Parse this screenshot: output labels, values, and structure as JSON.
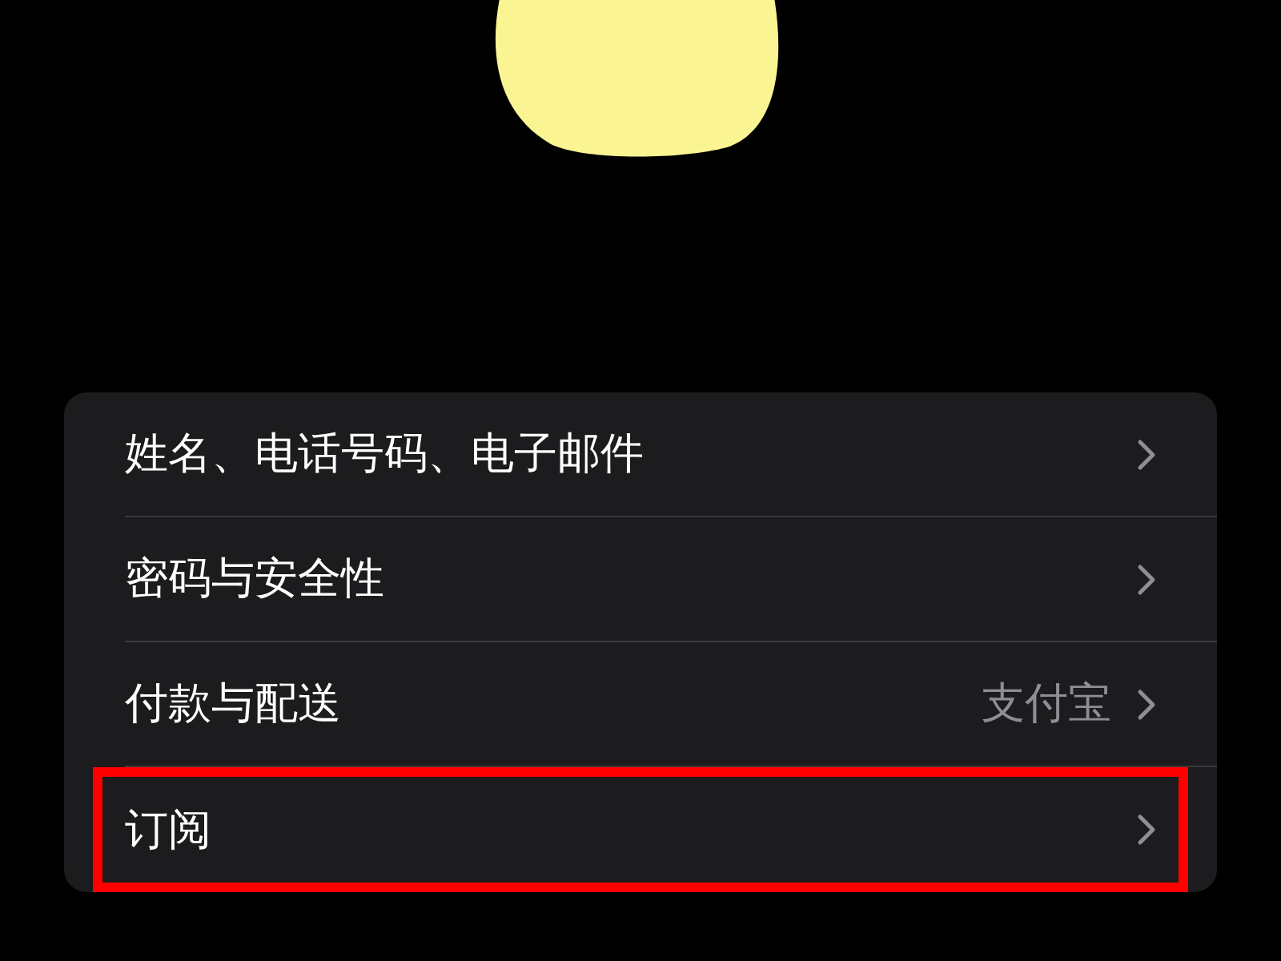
{
  "rows": [
    {
      "label": "姓名、电话号码、电子邮件",
      "highlighted": false
    },
    {
      "label": "密码与安全性",
      "highlighted": false
    },
    {
      "label": "付款与配送",
      "value": "支付宝",
      "highlighted": false
    },
    {
      "label": "订阅",
      "highlighted": true
    }
  ]
}
